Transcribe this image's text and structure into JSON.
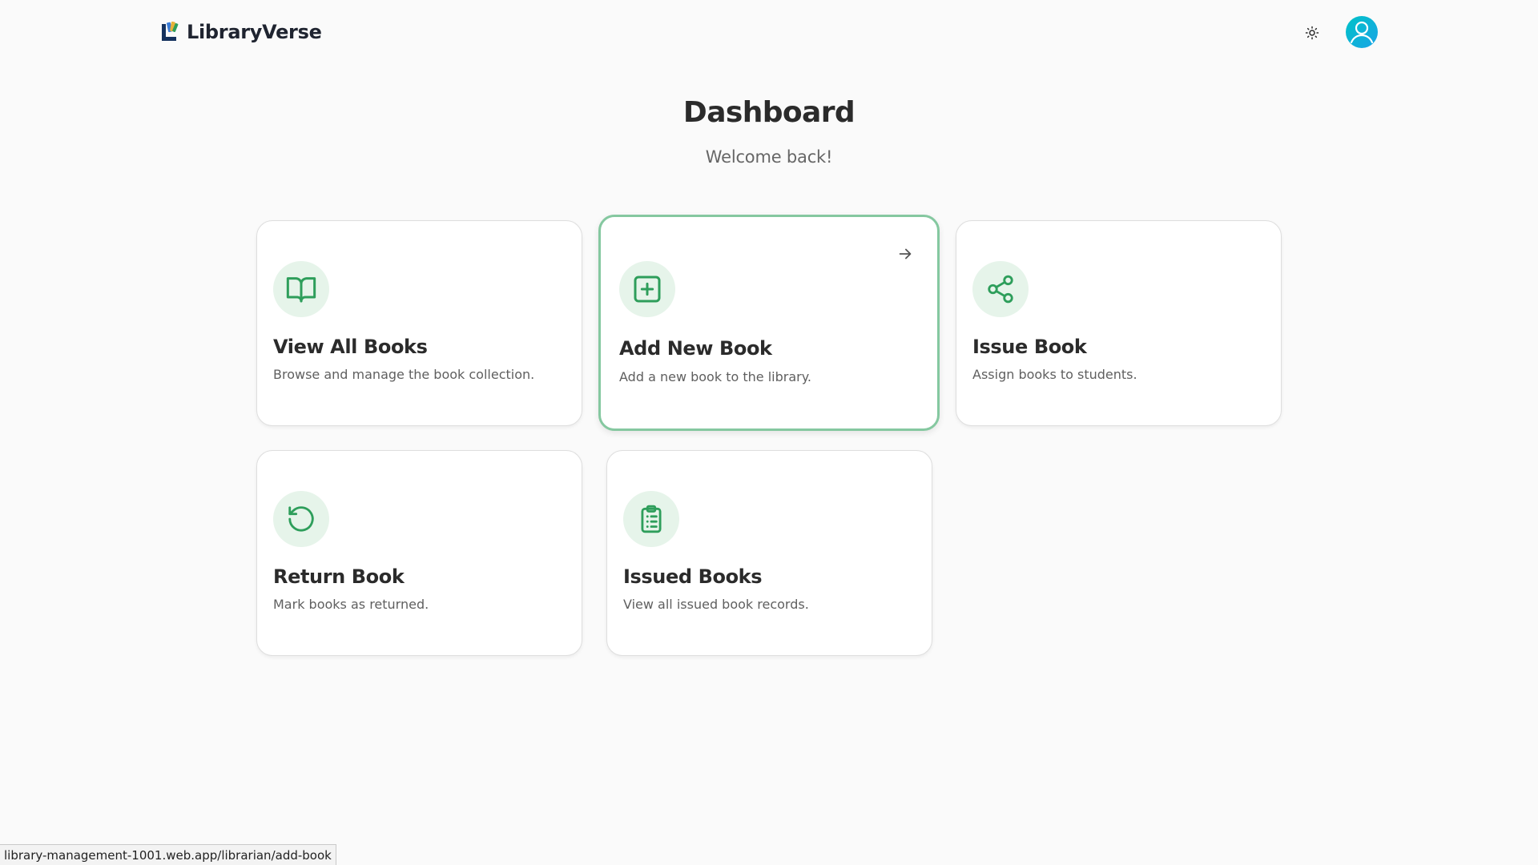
{
  "app": {
    "name": "LibraryVerse",
    "logo_icon": "library-logo-icon"
  },
  "header": {
    "theme_toggle_icon": "sun-icon",
    "avatar_icon": "user-avatar-icon"
  },
  "main": {
    "title": "Dashboard",
    "subtitle": "Welcome back!",
    "cards": [
      {
        "title": "View All Books",
        "description": "Browse and manage the book collection.",
        "icon": "open-book-icon"
      },
      {
        "title": "Add New Book",
        "description": "Add a new book to the library.",
        "icon": "plus-square-icon",
        "hovered": true
      },
      {
        "title": "Issue Book",
        "description": "Assign books to students.",
        "icon": "share-icon"
      },
      {
        "title": "Return Book",
        "description": "Mark books as returned.",
        "icon": "rotate-ccw-icon"
      },
      {
        "title": "Issued Books",
        "description": "View all issued book records.",
        "icon": "clipboard-list-icon"
      }
    ]
  },
  "status_bar": {
    "url": "library-management-1001.web.app/librarian/add-book"
  },
  "colors": {
    "accent": "#2e9e5b",
    "icon_bg": "#e6f4ea",
    "active_border": "#85c8a0",
    "avatar": "#00c2c7"
  }
}
